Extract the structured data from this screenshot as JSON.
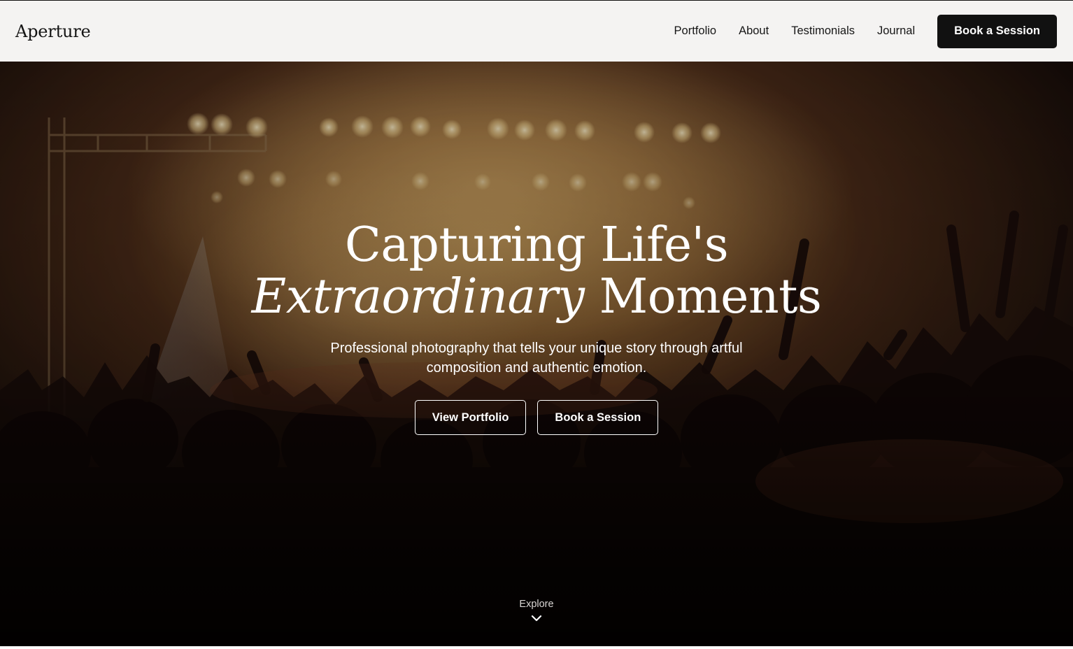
{
  "brand": {
    "name": "Aperture"
  },
  "nav": {
    "links": [
      "Portfolio",
      "About",
      "Testimonials",
      "Journal"
    ],
    "cta_label": "Book a Session"
  },
  "hero": {
    "title_line1": "Capturing Life's",
    "title_italic": "Extraordinary",
    "title_line2_rest": " Moments",
    "subtitle": "Professional photography that tells your unique story through artful composition and authentic emotion.",
    "primary_cta": "View Portfolio",
    "secondary_cta": "Book a Session",
    "explore_label": "Explore",
    "explore_icon": "chevron-down-icon",
    "background_image": "concert-crowd-photo"
  },
  "colors": {
    "header_bg": "#f4f3f2",
    "cta_bg": "#111111",
    "hero_text": "#ffffff",
    "stage_glow": "#c89a4a"
  }
}
